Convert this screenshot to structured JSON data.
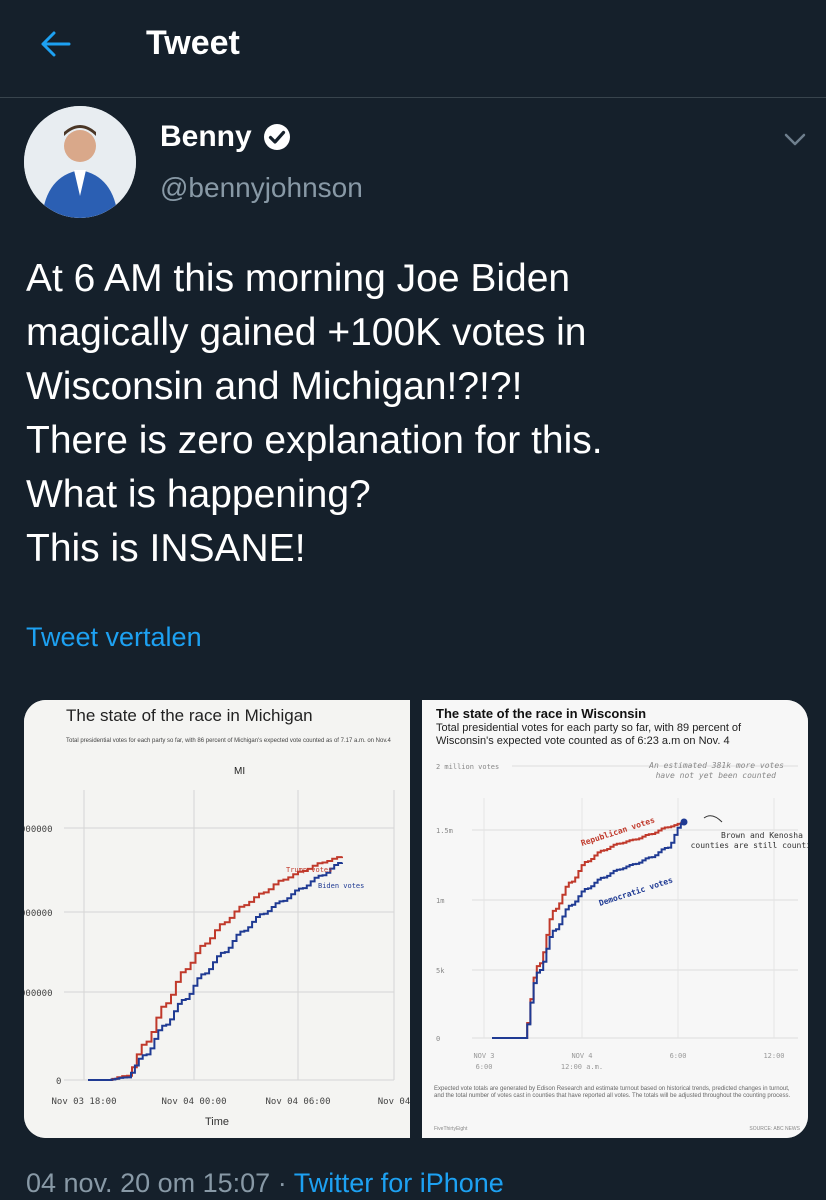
{
  "header": {
    "title": "Tweet"
  },
  "author": {
    "name": "Benny",
    "handle": "@bennyjohnson"
  },
  "tweet": {
    "text": "At 6 AM this morning Joe Biden\nmagically gained +100K votes in\nWisconsin and Michigan!?!?!\nThere is zero explanation for this.\nWhat is happening?\nThis is INSANE!",
    "translate_label": "Tweet vertalen"
  },
  "footer": {
    "timestamp": "04 nov. 20 om 15:07",
    "separator": " · ",
    "source": "Twitter for iPhone"
  },
  "colors": {
    "background": "#15202b",
    "accent": "#1da1f2",
    "muted": "#8899a6",
    "divider": "#38444d",
    "republican": "#c0392b",
    "democrat": "#1f3a93"
  },
  "icons": {
    "back": "arrow-left-icon",
    "verified": "verified-badge-icon",
    "more": "chevron-down-icon"
  },
  "chart_data": [
    {
      "type": "line",
      "title": "The state of the race in Michigan",
      "subtitle": "Total presidential votes for each party so far, with 86 percent of Michigan's expected vote counted as of 7.17 a.m. on Nov.4",
      "panel_label": "MI",
      "xlabel": "Time",
      "x_ticks": [
        "Nov 03 18:00",
        "Nov 04 00:00",
        "Nov 04 06:00",
        "Nov 04"
      ],
      "y_ticks": [
        "0",
        "000000",
        "000000",
        "000000"
      ],
      "series": [
        {
          "name": "Trump votes",
          "color": "#c0392b",
          "values": [
            0,
            0,
            0.05,
            0.45,
            0.9,
            1.3,
            1.6,
            1.85,
            2.05,
            2.2,
            2.35,
            2.45,
            2.55,
            2.62
          ]
        },
        {
          "name": "Biden votes",
          "color": "#1f3a93",
          "values": [
            0,
            0,
            0.03,
            0.3,
            0.65,
            0.95,
            1.25,
            1.5,
            1.75,
            1.95,
            2.1,
            2.25,
            2.4,
            2.55
          ]
        }
      ]
    },
    {
      "type": "line",
      "title": "The state of the race in Wisconsin",
      "subtitle": "Total presidential votes for each party so far, with 89 percent of Wisconsin's expected vote counted as of 6:23 a.m on Nov. 4",
      "y_ticks": [
        "0",
        "5k",
        "1m",
        "1.5m",
        "2 million votes"
      ],
      "x_ticks": [
        "NOV 3\n6:00",
        "NOV 4\n12:00 a.m.",
        "6:00",
        "12:00"
      ],
      "annotations": [
        "An estimated 381k more votes have not yet been counted",
        "Brown and Kenosha counties are still counting."
      ],
      "series": [
        {
          "name": "Republican votes",
          "color": "#c0392b",
          "values": [
            0,
            0,
            0,
            0.55,
            0.95,
            1.15,
            1.3,
            1.38,
            1.43,
            1.46,
            1.5,
            1.55,
            1.58
          ]
        },
        {
          "name": "Democratic votes",
          "color": "#1f3a93",
          "values": [
            0,
            0,
            0,
            0.5,
            0.8,
            0.98,
            1.1,
            1.18,
            1.24,
            1.28,
            1.33,
            1.4,
            1.58
          ]
        }
      ],
      "note": "Expected vote totals are generated by Edison Research and estimate turnout based on historical trends, predicted changes in turnout, and the total number of votes cast in counties that have reported all votes. The totals will be adjusted throughout the counting process.",
      "credit": "FiveThirtyEight",
      "source": "SOURCE: ABC NEWS"
    }
  ]
}
